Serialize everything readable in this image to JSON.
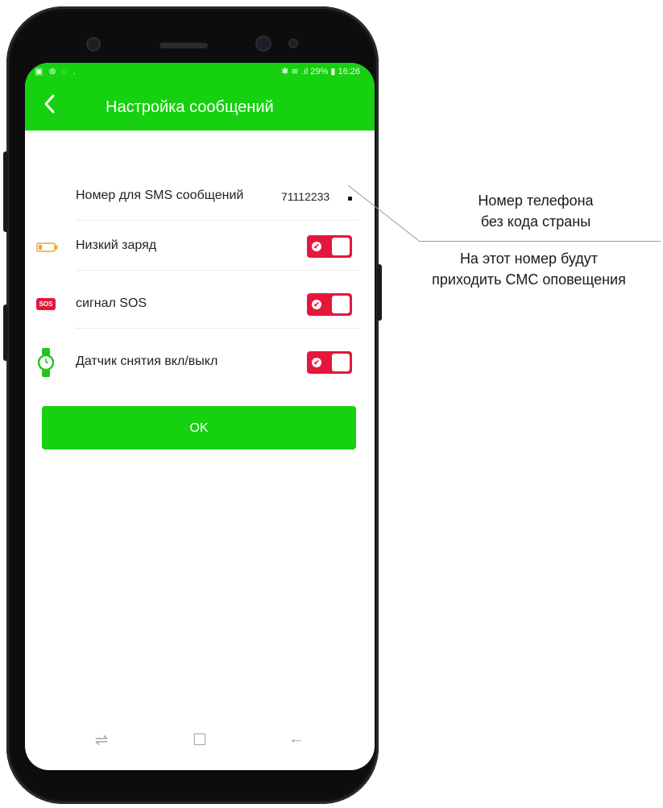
{
  "status_bar": {
    "left_icons": "▣ ⊛ ◌ .",
    "right": "✱ ≋ .ıl 29% ▮ 16:26"
  },
  "app_bar": {
    "back_icon": "chevron-left-icon",
    "title": "Настройка сообщений"
  },
  "settings": {
    "sms_number_label": "Номер для SMS сообщений",
    "sms_number_value": "71112233",
    "rows": [
      {
        "label": "Низкий заряд",
        "icon": "battery-low-icon",
        "enabled": true
      },
      {
        "label": "сигнал SOS",
        "icon": "sos-icon",
        "icon_text": "SOS",
        "enabled": true
      },
      {
        "label": "Датчик снятия вкл/выкл",
        "icon": "watch-icon",
        "enabled": true
      }
    ]
  },
  "ok_button": {
    "label": "OK"
  },
  "nav_bar": {
    "recent_glyph": "⇌",
    "home_glyph": "☐",
    "back_glyph": "←"
  },
  "annotation": {
    "line1": "Номер телефона",
    "line2": "без кода страны",
    "line3": "На этот номер будут",
    "line4": "приходить СМС оповещения"
  },
  "colors": {
    "accent_green": "#15d10f",
    "toggle_red": "#e5173c",
    "battery_orange": "#f5a623",
    "watch_green": "#22c31c"
  }
}
